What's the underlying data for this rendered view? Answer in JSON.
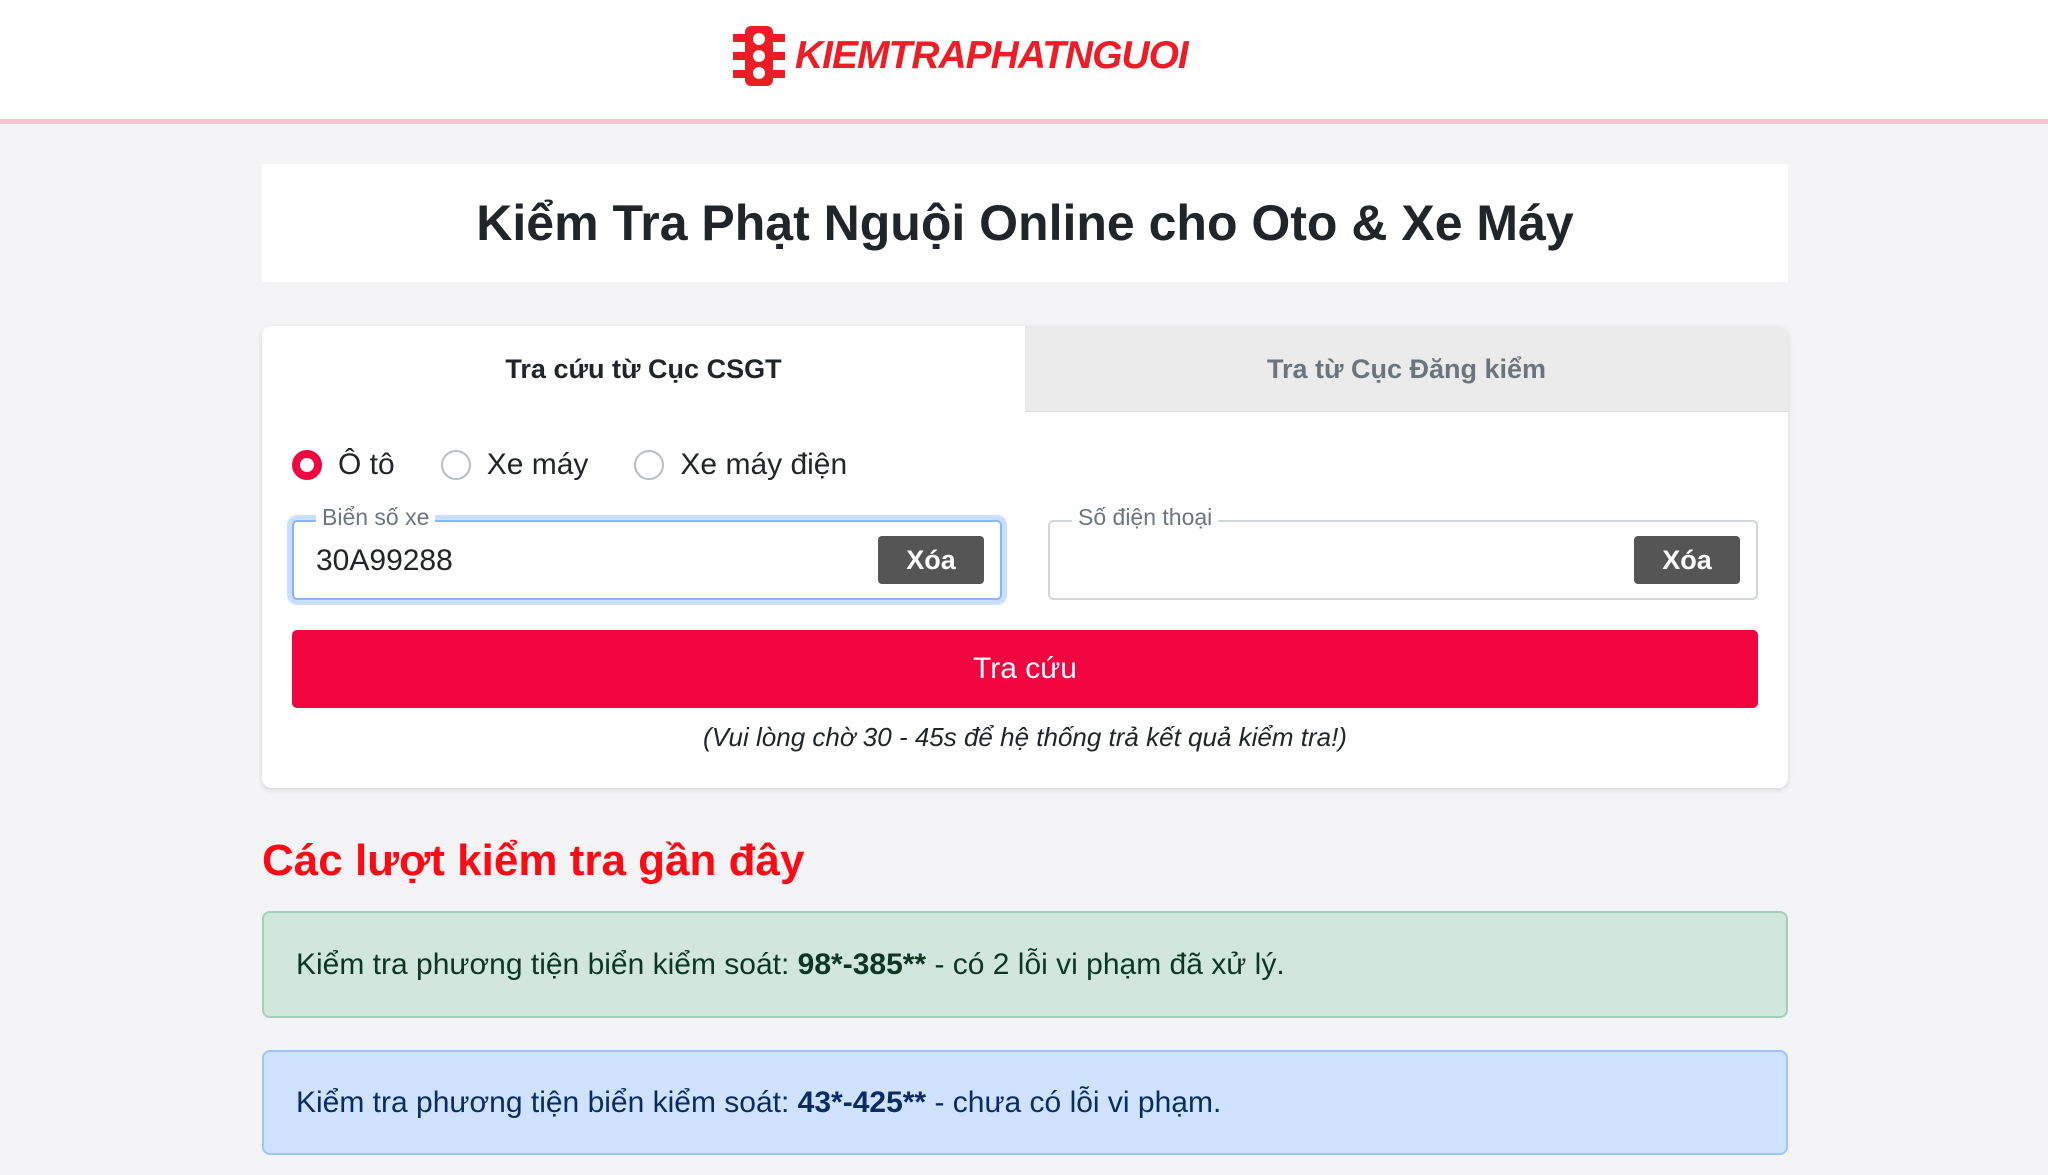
{
  "header": {
    "logo_text": "KIEMTRAPHATNGUOI",
    "brand_color": "#ee1c25",
    "logo_icon": "traffic-light-icon"
  },
  "title": "Kiểm Tra Phạt Nguội Online cho Oto & Xe Máy",
  "tabs": [
    {
      "label": "Tra cứu từ Cục CSGT",
      "active": true
    },
    {
      "label": "Tra từ Cục Đăng kiểm",
      "active": false
    }
  ],
  "vehicle_types": [
    {
      "label": "Ô tô",
      "checked": true
    },
    {
      "label": "Xe máy",
      "checked": false
    },
    {
      "label": "Xe máy điện",
      "checked": false
    }
  ],
  "plate_field": {
    "legend": "Biển số xe",
    "value": "30A99288",
    "clear_label": "Xóa"
  },
  "phone_field": {
    "legend": "Số điện thoại",
    "value": "",
    "clear_label": "Xóa"
  },
  "submit_label": "Tra cứu",
  "wait_note": "(Vui lòng chờ 30 - 45s để hệ thống trả kết quả kiểm tra!)",
  "recent": {
    "title": "Các lượt kiểm tra gần đây",
    "items": [
      {
        "prefix": "Kiểm tra phương tiện biển kiểm soát: ",
        "plate": "98*-385**",
        "suffix": " - có 2 lỗi vi phạm đã xử lý.",
        "status": "success"
      },
      {
        "prefix": "Kiểm tra phương tiện biển kiểm soát: ",
        "plate": "43*-425**",
        "suffix": " - chưa có lỗi vi phạm.",
        "status": "info"
      }
    ]
  },
  "colors": {
    "accent": "#f0053f",
    "success_bg": "#d1e7dd",
    "info_bg": "#cfe2ff"
  }
}
